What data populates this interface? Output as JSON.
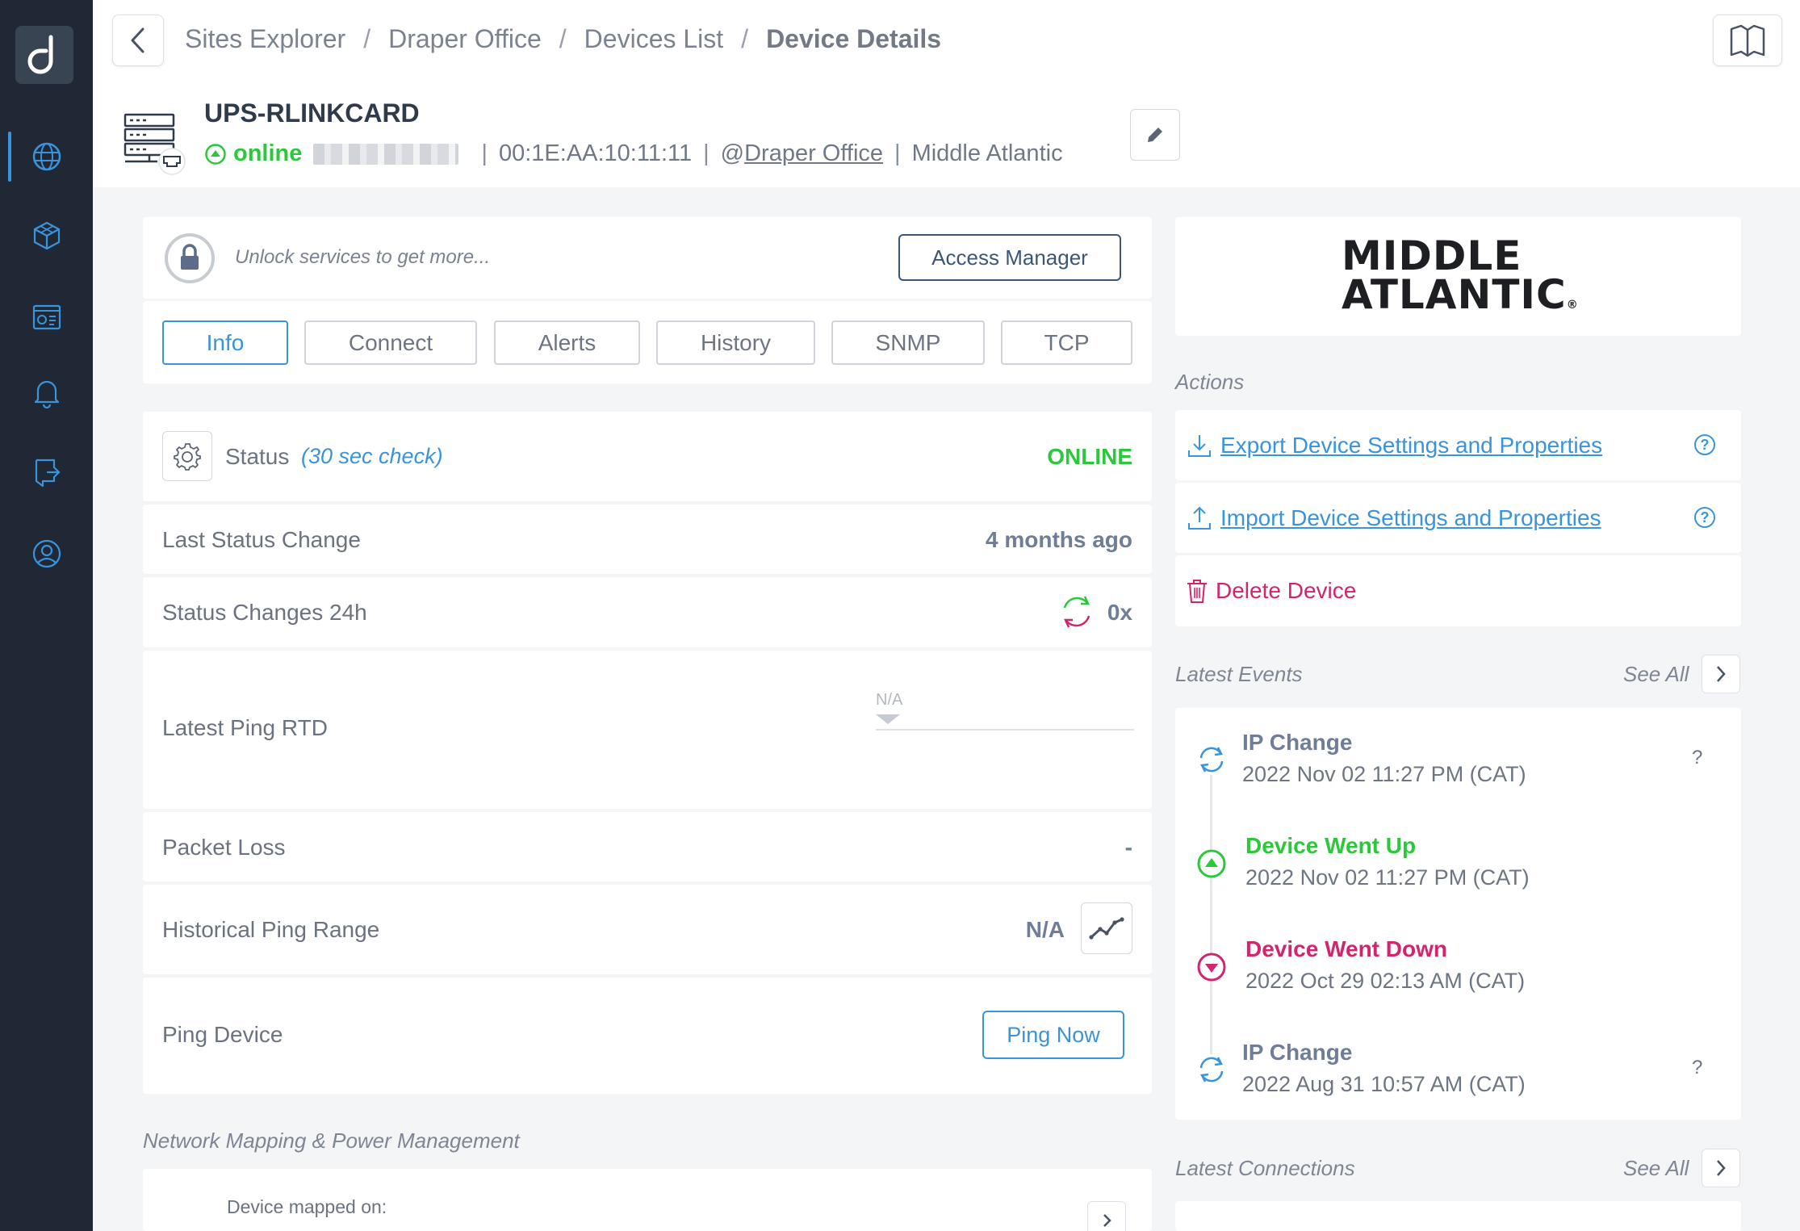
{
  "sidebar": {
    "logo": "d",
    "items": [
      {
        "icon": "globe-icon",
        "active": true
      },
      {
        "icon": "cube-icon",
        "active": false
      },
      {
        "icon": "dashboard-icon",
        "active": false
      },
      {
        "icon": "bell-icon",
        "active": false
      },
      {
        "icon": "export-icon",
        "active": false
      },
      {
        "icon": "user-circle-icon",
        "active": false
      }
    ]
  },
  "breadcrumb": {
    "items": [
      "Sites Explorer",
      "Draper Office",
      "Devices List"
    ],
    "separator": "/",
    "current": "Device Details"
  },
  "device": {
    "name": "UPS-RLINKCARD",
    "status": "online",
    "mac": "00:1E:AA:10:11:11",
    "site_prefix": "@",
    "site": "Draper Office",
    "vendor": "Middle Atlantic"
  },
  "services": {
    "unlock_text": "Unlock services to get more...",
    "access_manager_label": "Access Manager"
  },
  "tabs": [
    "Info",
    "Connect",
    "Alerts",
    "History",
    "SNMP",
    "TCP"
  ],
  "info": {
    "status_label": "Status",
    "status_check": "(30 sec check)",
    "status_value": "ONLINE",
    "last_status_change_label": "Last Status Change",
    "last_status_change_value": "4 months ago",
    "status_changes_label": "Status Changes 24h",
    "status_changes_value": "0x",
    "latest_ping_label": "Latest Ping RTD",
    "latest_ping_value": "N/A",
    "packet_loss_label": "Packet Loss",
    "packet_loss_value": "-",
    "historical_ping_label": "Historical Ping Range",
    "historical_ping_value": "N/A",
    "ping_device_label": "Ping Device",
    "ping_now_label": "Ping Now"
  },
  "network_mapping": {
    "title": "Network Mapping & Power Management",
    "mapped_on_label": "Device mapped on:"
  },
  "vendor_logo": {
    "line1": "MIDDLE",
    "line2": "ATLANTIC",
    "mark": "®"
  },
  "actions": {
    "title": "Actions",
    "export_label": "Export Device Settings and Properties",
    "import_label": "Import Device Settings and Properties",
    "help_glyph": "?",
    "delete_label": "Delete Device"
  },
  "latest_events": {
    "title": "Latest Events",
    "see_all": "See All",
    "items": [
      {
        "title": "IP Change",
        "time": "2022 Nov 02 11:27 PM (CAT)",
        "type": "ip-change",
        "extra": "?"
      },
      {
        "title": "Device Went Up",
        "time": "2022 Nov 02 11:27 PM (CAT)",
        "type": "up",
        "extra": ""
      },
      {
        "title": "Device Went Down",
        "time": "2022 Oct 29 02:13 AM (CAT)",
        "type": "down",
        "extra": ""
      },
      {
        "title": "IP Change",
        "time": "2022 Aug 31 10:57 AM (CAT)",
        "type": "ip-change",
        "extra": "?"
      }
    ]
  },
  "latest_connections": {
    "title": "Latest Connections",
    "see_all": "See All"
  },
  "colors": {
    "sidebar_bg": "#1f2834",
    "accent": "#3a94db",
    "online": "#2cc83c",
    "danger": "#d2256d"
  }
}
